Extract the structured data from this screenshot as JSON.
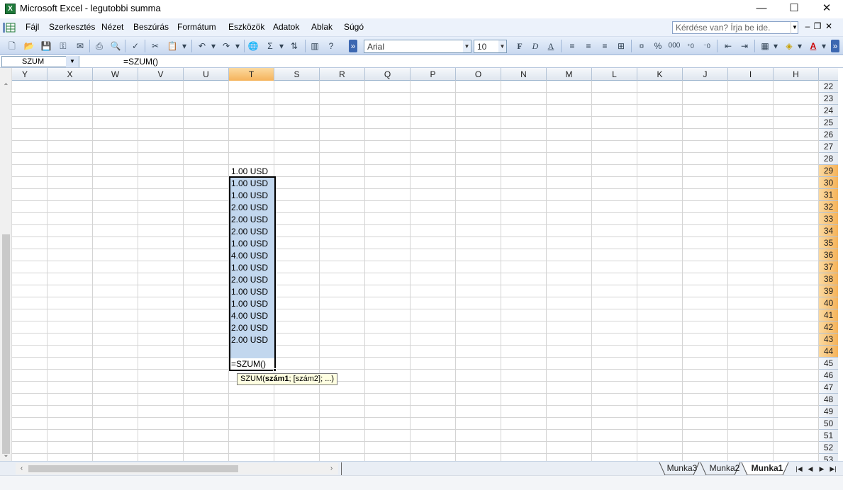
{
  "window": {
    "title": "Microsoft Excel - legutobbi summa",
    "minimize": "—",
    "maximize": "☐",
    "close": "✕"
  },
  "menu": {
    "items": [
      "Fájl",
      "Szerkesztés",
      "Nézet",
      "Beszúrás",
      "Formátum",
      "Eszközök",
      "Adatok",
      "Ablak",
      "Súgó"
    ],
    "ask_placeholder": "Kérdése van? Írja be ide."
  },
  "toolbar": {
    "font_name": "Arial",
    "font_size": "10"
  },
  "formula_bar": {
    "name_box": "SZUM",
    "formula": "=SZUM()"
  },
  "columns": [
    "Y",
    "X",
    "W",
    "V",
    "U",
    "T",
    "S",
    "R",
    "Q",
    "P",
    "O",
    "N",
    "M",
    "L",
    "K",
    "J",
    "I",
    "H"
  ],
  "selected_column": "T",
  "rows": [
    "22",
    "23",
    "24",
    "25",
    "26",
    "27",
    "28",
    "29",
    "30",
    "31",
    "32",
    "33",
    "34",
    "35",
    "36",
    "37",
    "38",
    "39",
    "40",
    "41",
    "42",
    "43",
    "44",
    "45",
    "46",
    "47",
    "48",
    "49",
    "50",
    "51",
    "52",
    "53"
  ],
  "selected_rows": [
    "29",
    "30",
    "31",
    "32",
    "33",
    "34",
    "35",
    "36",
    "37",
    "38",
    "39",
    "40",
    "41",
    "42",
    "43",
    "44"
  ],
  "cells_T": [
    "1.00 USD",
    "1.00 USD",
    "1.00 USD",
    "2.00 USD",
    "2.00 USD",
    "2.00 USD",
    "1.00 USD",
    "4.00 USD",
    "1.00 USD",
    "2.00 USD",
    "1.00 USD",
    "1.00 USD",
    "4.00 USD",
    "2.00 USD",
    "2.00 USD"
  ],
  "editing_cell": "=SZUM()",
  "tooltip": {
    "prefix": "SZUM(",
    "bold": "szám1",
    "suffix": "; [szám2]; ...)"
  },
  "sheets": [
    "Munka3",
    "Munka2",
    "Munka1"
  ],
  "active_sheet": "Munka1",
  "colors": {
    "selection_fill": "#c2d7ee",
    "header_highlight": "#f5b35a",
    "excel_green": "#1f7a3a"
  }
}
